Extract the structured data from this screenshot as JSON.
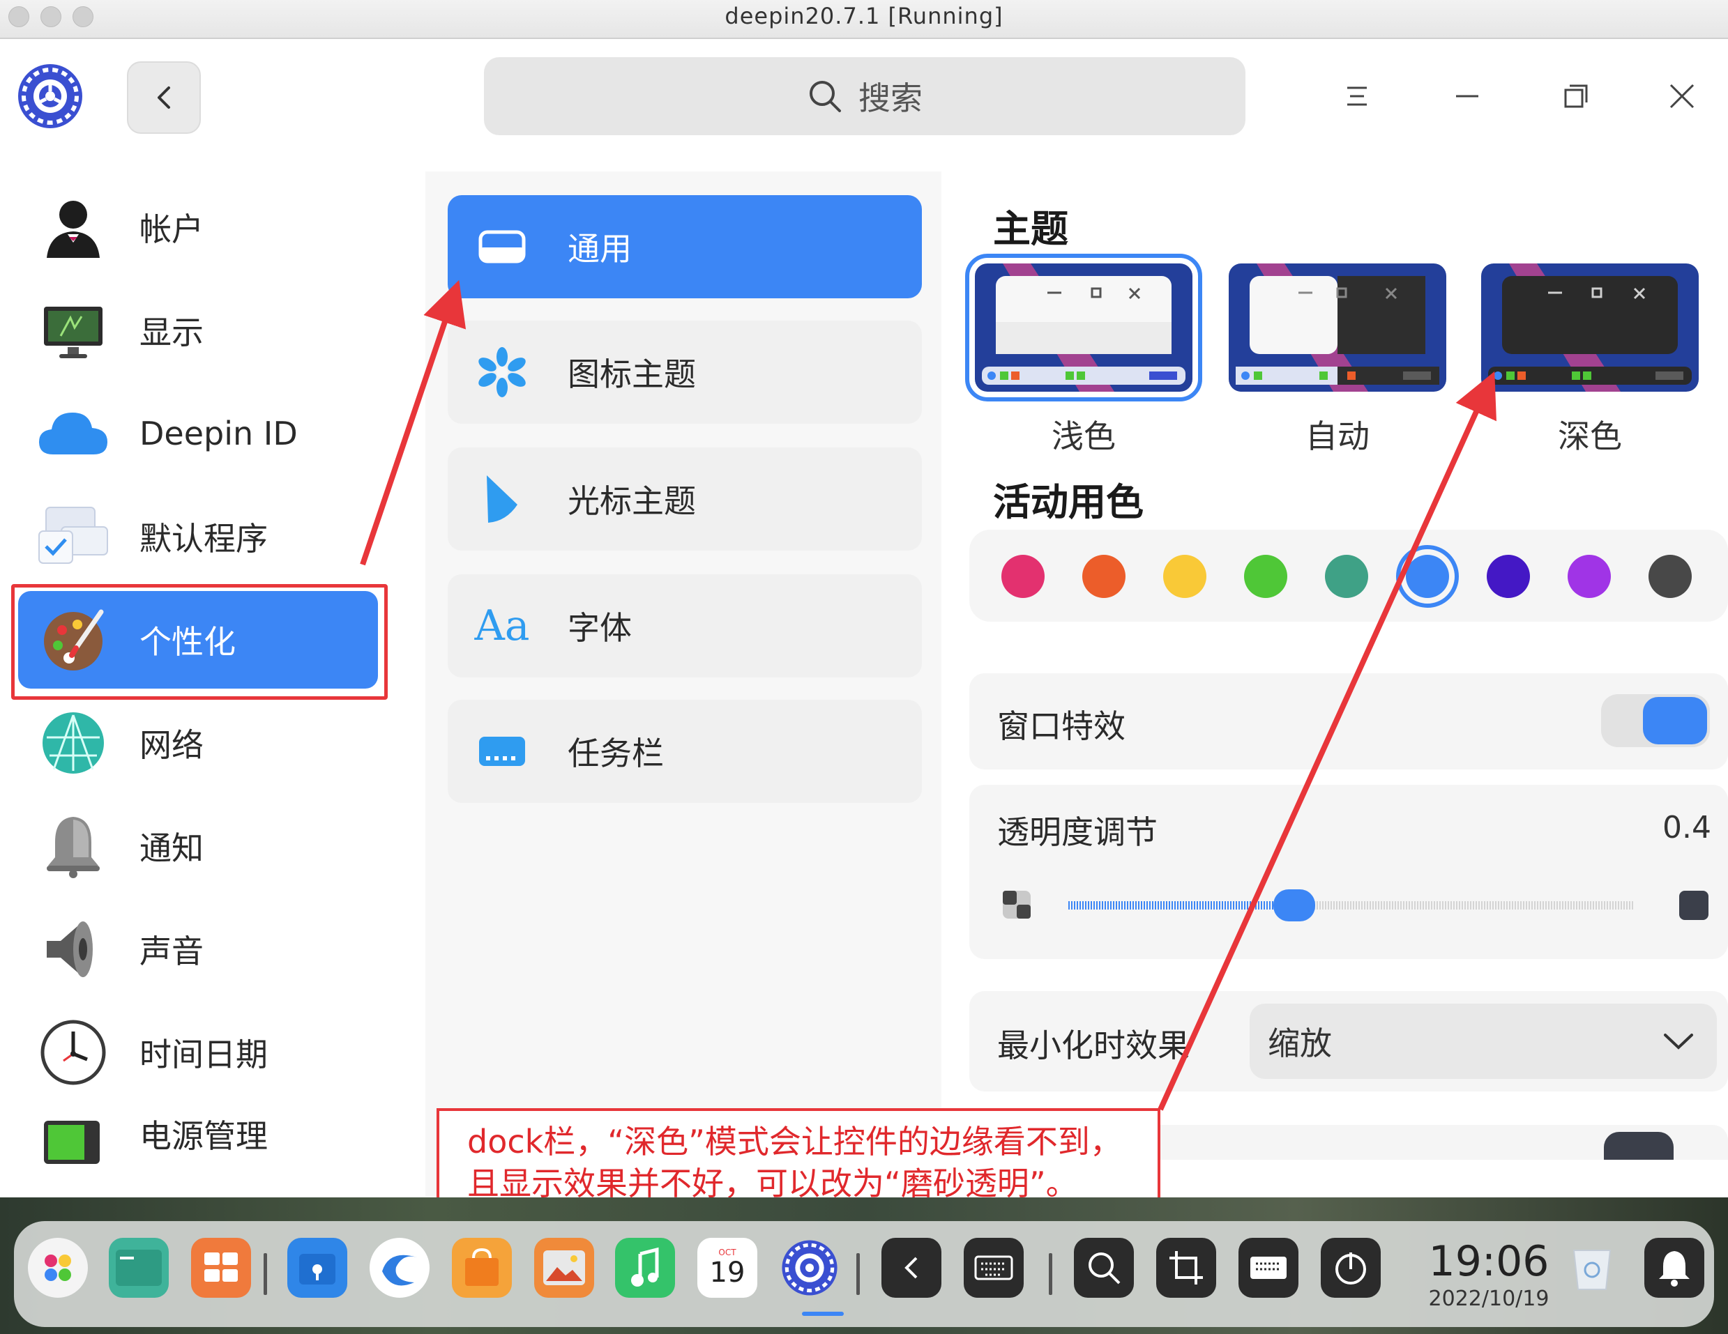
{
  "host": {
    "title": "deepin20.7.1 [Running]"
  },
  "header": {
    "search_placeholder": "搜索",
    "icons": [
      "settings-logo-icon",
      "back-arrow-icon",
      "search-icon",
      "menu-icon",
      "minimize-icon",
      "maximize-icon",
      "close-icon"
    ]
  },
  "sidebar": {
    "items": [
      {
        "label": "帐户",
        "icon": "account-icon"
      },
      {
        "label": "显示",
        "icon": "display-icon"
      },
      {
        "label": "Deepin ID",
        "icon": "cloud-icon"
      },
      {
        "label": "默认程序",
        "icon": "default-apps-icon"
      },
      {
        "label": "个性化",
        "icon": "personalization-icon",
        "active": true
      },
      {
        "label": "网络",
        "icon": "network-icon"
      },
      {
        "label": "通知",
        "icon": "notification-bell-icon"
      },
      {
        "label": "声音",
        "icon": "speaker-icon"
      },
      {
        "label": "时间日期",
        "icon": "clock-icon"
      },
      {
        "label": "电源管理",
        "icon": "battery-icon"
      }
    ]
  },
  "subnav": {
    "items": [
      {
        "label": "通用",
        "icon": "window-general-icon",
        "active": true
      },
      {
        "label": "图标主题",
        "icon": "icon-theme-icon"
      },
      {
        "label": "光标主题",
        "icon": "cursor-icon"
      },
      {
        "label": "字体",
        "icon": "font-icon",
        "glyph": "Aa"
      },
      {
        "label": "任务栏",
        "icon": "dock-icon"
      }
    ]
  },
  "panel": {
    "theme": {
      "title": "主题",
      "options": [
        {
          "label": "浅色",
          "selected": true
        },
        {
          "label": "自动"
        },
        {
          "label": "深色"
        }
      ]
    },
    "accent": {
      "title": "活动用色",
      "colors": [
        "#e3316f",
        "#ec5d2a",
        "#f9c937",
        "#4fc737",
        "#3fa186",
        "#3c86f5",
        "#4418c5",
        "#a034e6",
        "#484848"
      ],
      "selected_index": 5
    },
    "window_effect": {
      "label": "窗口特效",
      "on": true
    },
    "transparency": {
      "label": "透明度调节",
      "value": "0.4",
      "fraction": 0.4
    },
    "minimize_effect": {
      "label": "最小化时效果",
      "value": "缩放"
    }
  },
  "annotation": {
    "text_line1": "dock栏，“深色”模式会让控件的边缘看不到，",
    "text_line2": "且显示效果并不好，可以改为“磨砂透明”。",
    "color": "#e8363a"
  },
  "dock": {
    "time": "19:06",
    "date": "2022/10/19",
    "calendar_month": "OCT",
    "calendar_day": "19",
    "icons": [
      "launcher-icon",
      "terminal-icon",
      "multitask-view-icon",
      "file-manager-icon",
      "browser-icon",
      "app-store-icon",
      "image-viewer-icon",
      "music-icon",
      "calendar-icon",
      "control-center-icon",
      "back-arrow-icon",
      "keyboard-icon",
      "search-icon",
      "screenshot-icon",
      "onscreen-keyboard-icon",
      "power-icon",
      "trash-icon",
      "notification-bell-icon"
    ]
  }
}
